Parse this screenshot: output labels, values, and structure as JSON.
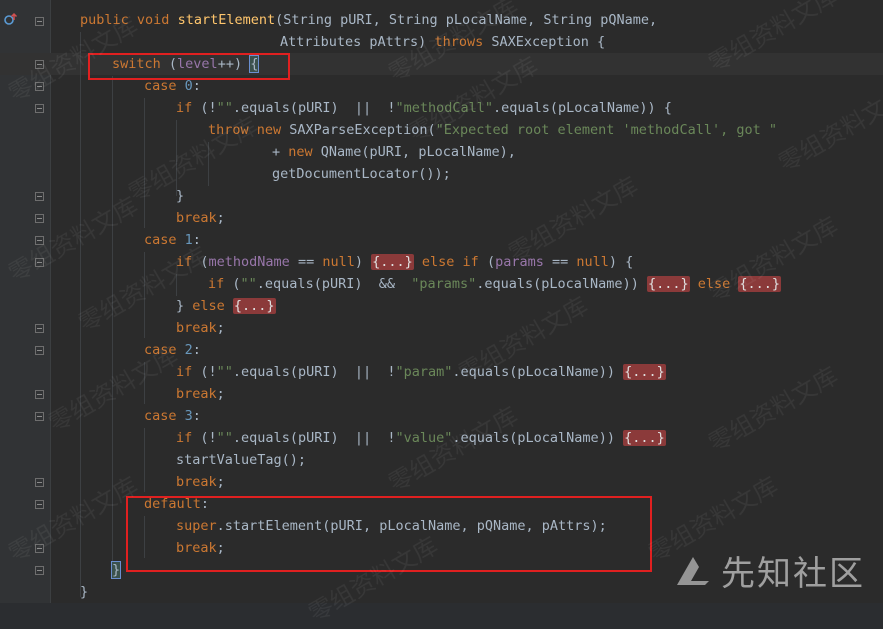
{
  "code": {
    "sig1": [
      "public",
      " ",
      "void",
      " ",
      "startElement",
      "(String pURI, String pLocalName, String pQName,"
    ],
    "sig2": [
      "Attributes pAttrs) ",
      "throws",
      " SAXException {"
    ],
    "sw": [
      "switch",
      " (",
      "level",
      "++) ",
      "{"
    ],
    "case0": [
      "case",
      " ",
      "0",
      ":"
    ],
    "if0": [
      "if",
      " (!",
      "\"\"",
      ".equals(pURI)  ||  !",
      "\"methodCall\"",
      ".equals(pLocalName)) {"
    ],
    "throw0": [
      "throw",
      " ",
      "new",
      " SAXParseException(",
      "\"Expected root element 'methodCall', got \""
    ],
    "plus0": [
      "+ ",
      "new",
      " QName(pURI, pLocalName),"
    ],
    "loc0": "getDocumentLocator());",
    "close0": "}",
    "break_kw": "break",
    "case1": [
      "case",
      " ",
      "1",
      ":"
    ],
    "if1": [
      "if",
      " (",
      "methodName",
      " == ",
      "null",
      ") ",
      "{...}",
      " ",
      "else",
      " ",
      "if",
      " (",
      "params",
      " == ",
      "null",
      ") {"
    ],
    "if1b": [
      "if",
      " (",
      "\"\"",
      ".equals(pURI)  &&  ",
      "\"params\"",
      ".equals(pLocalName)) ",
      "{...}",
      " ",
      "else",
      " ",
      "{...}"
    ],
    "else1": [
      "} ",
      "else",
      " ",
      "{...}"
    ],
    "case2": [
      "case",
      " ",
      "2",
      ":"
    ],
    "if2": [
      "if",
      " (!",
      "\"\"",
      ".equals(pURI)  ||  !",
      "\"param\"",
      ".equals(pLocalName)) ",
      "{...}"
    ],
    "case3": [
      "case",
      " ",
      "3",
      ":"
    ],
    "if3": [
      "if",
      " (!",
      "\"\"",
      ".equals(pURI)  ||  !",
      "\"value\"",
      ".equals(pLocalName)) ",
      "{...}"
    ],
    "svt": "startValueTag();",
    "default_kw": "default",
    "colon": ":",
    "super": [
      "super",
      ".startElement(pURI, pLocalName, pQName, pAttrs);"
    ],
    "close_sw": "}",
    "close_m": "}"
  },
  "watermark_text": "零组资料文库",
  "brand": "先知社区",
  "icons": {
    "gutter_icon": "override-method-icon",
    "fold": "fold-marker-icon"
  },
  "colors": {
    "keyword": "#cc7832",
    "method": "#ffc66d",
    "string": "#6a8759",
    "number": "#6897bb",
    "field": "#9876aa",
    "highlight_box": "#e02020"
  }
}
